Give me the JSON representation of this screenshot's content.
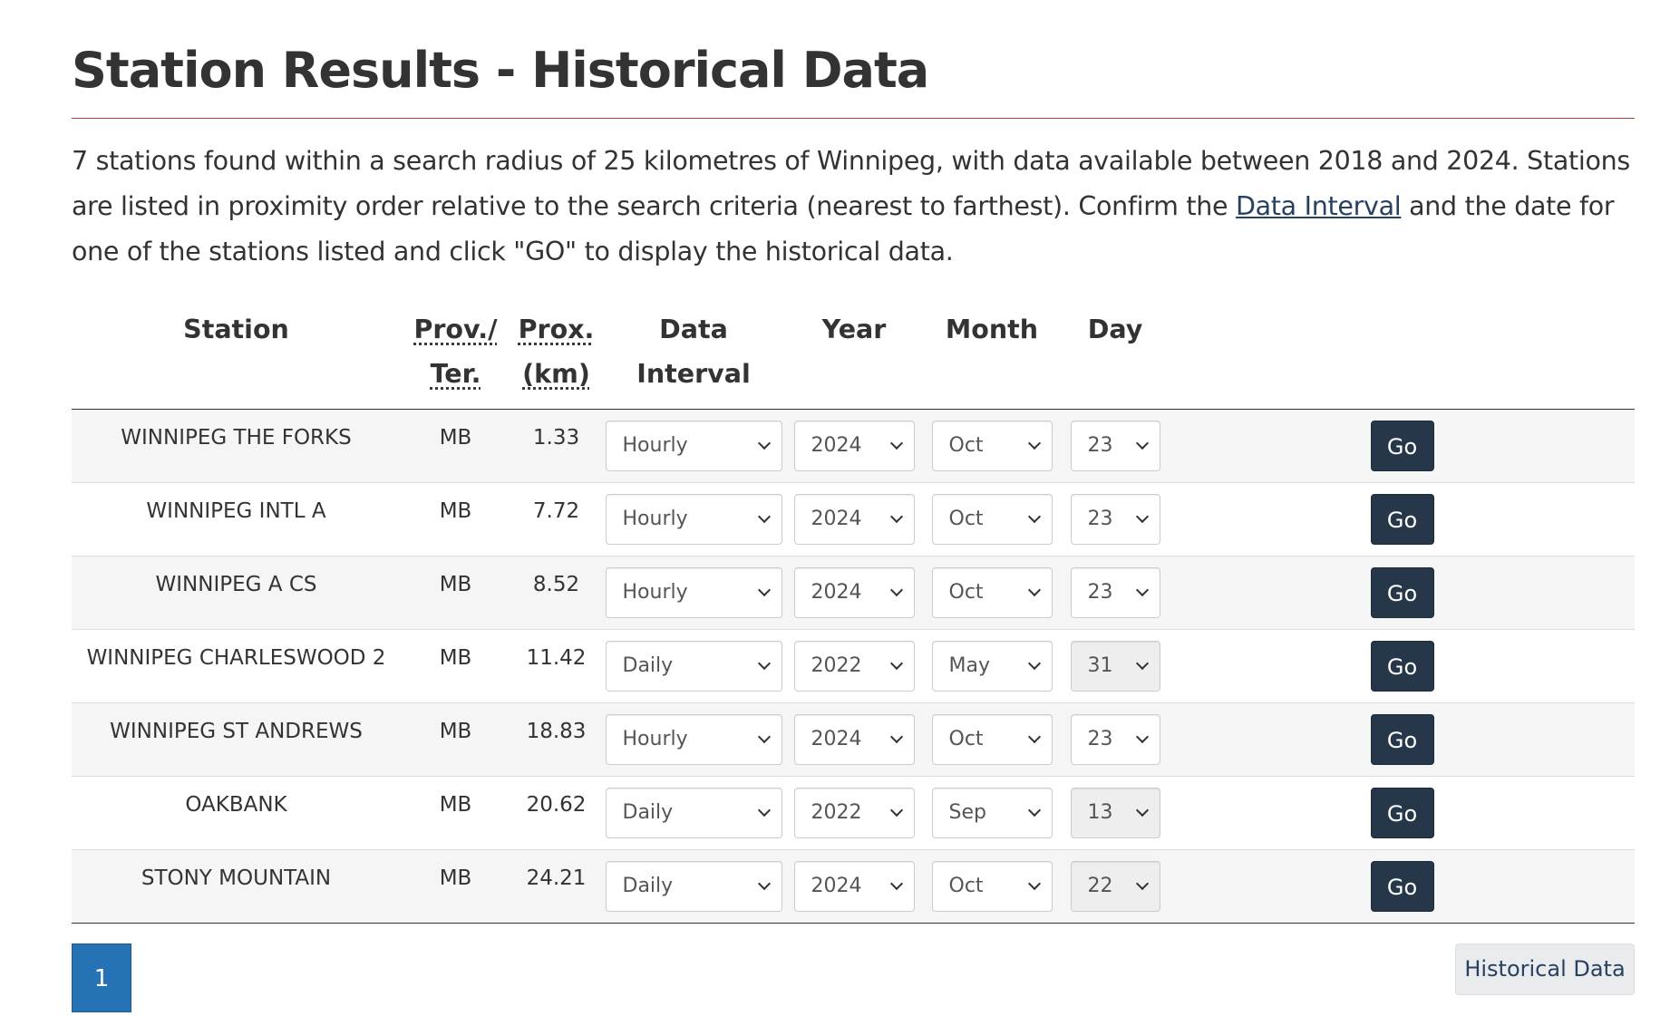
{
  "page": {
    "title": "Station Results - Historical Data",
    "intro_before_link": "7 stations found within a search radius of 25 kilometres of Winnipeg, with data available between 2018 and 2024. Stations are listed in proximity order relative to the search criteria (nearest to farthest). Confirm the ",
    "intro_link": "Data Interval",
    "intro_after_link": " and the date for one of the stations listed and click \"GO\" to display the historical data."
  },
  "table": {
    "headers": {
      "station": "Station",
      "prov_line1": "Prov./",
      "prov_line2": "Ter.",
      "prox_line1": "Prox.",
      "prox_line2": "(km)",
      "interval_line1": "Data",
      "interval_line2": "Interval",
      "year": "Year",
      "month": "Month",
      "day": "Day"
    },
    "go_label": "Go",
    "rows": [
      {
        "station": "WINNIPEG THE FORKS",
        "prov": "MB",
        "prox": "1.33",
        "interval": "Hourly",
        "year": "2024",
        "month": "Oct",
        "day": "23",
        "day_disabled": false
      },
      {
        "station": "WINNIPEG INTL A",
        "prov": "MB",
        "prox": "7.72",
        "interval": "Hourly",
        "year": "2024",
        "month": "Oct",
        "day": "23",
        "day_disabled": false
      },
      {
        "station": "WINNIPEG A CS",
        "prov": "MB",
        "prox": "8.52",
        "interval": "Hourly",
        "year": "2024",
        "month": "Oct",
        "day": "23",
        "day_disabled": false
      },
      {
        "station": "WINNIPEG CHARLESWOOD 2",
        "prov": "MB",
        "prox": "11.42",
        "interval": "Daily",
        "year": "2022",
        "month": "May",
        "day": "31",
        "day_disabled": true
      },
      {
        "station": "WINNIPEG ST ANDREWS",
        "prov": "MB",
        "prox": "18.83",
        "interval": "Hourly",
        "year": "2024",
        "month": "Oct",
        "day": "23",
        "day_disabled": false
      },
      {
        "station": "OAKBANK",
        "prov": "MB",
        "prox": "20.62",
        "interval": "Daily",
        "year": "2022",
        "month": "Sep",
        "day": "13",
        "day_disabled": true
      },
      {
        "station": "STONY MOUNTAIN",
        "prov": "MB",
        "prox": "24.21",
        "interval": "Daily",
        "year": "2024",
        "month": "Oct",
        "day": "22",
        "day_disabled": true
      }
    ]
  },
  "pagination": {
    "current_page": "1"
  },
  "buttons": {
    "historical_data": "Historical Data"
  },
  "colors": {
    "title_rule": "#af3c43",
    "go_button": "#26374a",
    "page_active": "#2572b4",
    "link": "#284162"
  },
  "icons": {
    "select_arrow": "chevron-down-icon"
  }
}
